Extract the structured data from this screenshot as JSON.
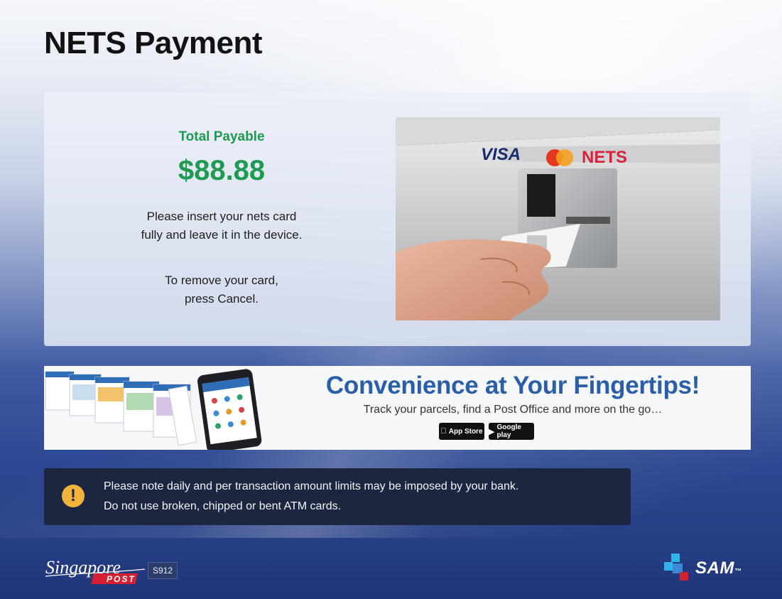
{
  "screen": {
    "title": "NETS Payment"
  },
  "payment": {
    "total_label": "Total Payable",
    "total_amount": "$88.88",
    "instruction_line1": "Please insert your nets card",
    "instruction_line2": "fully and leave it in the device.",
    "cancel_line1": "To remove your card,",
    "cancel_line2": "press Cancel."
  },
  "terminal_image": {
    "brands": [
      "VISA",
      "MasterCard",
      "NETS"
    ]
  },
  "promo": {
    "title": "Convenience at Your Fingertips!",
    "subtitle": "Track your parcels, find a Post Office and more on the go…",
    "badges": [
      {
        "label": "App Store",
        "icon": "apple-icon"
      },
      {
        "label": "Google play",
        "icon": "play-icon"
      }
    ]
  },
  "notice": {
    "icon": "warning-icon",
    "line1": "Please note daily and per transaction amount limits may be imposed by your bank.",
    "line2": "Do not use broken, chipped or bent ATM cards."
  },
  "footer": {
    "brand_script": "Singapore",
    "brand_post": "POST",
    "terminal_id": "S912",
    "sam_label": "SAM",
    "sam_tm": "™"
  },
  "colors": {
    "accent_green": "#1f9a52",
    "promo_blue": "#2a5fa8",
    "notice_bg": "#1d2640",
    "warning_yellow": "#f2b33c",
    "footer_blue": "#263f85",
    "sp_red": "#d42031"
  }
}
